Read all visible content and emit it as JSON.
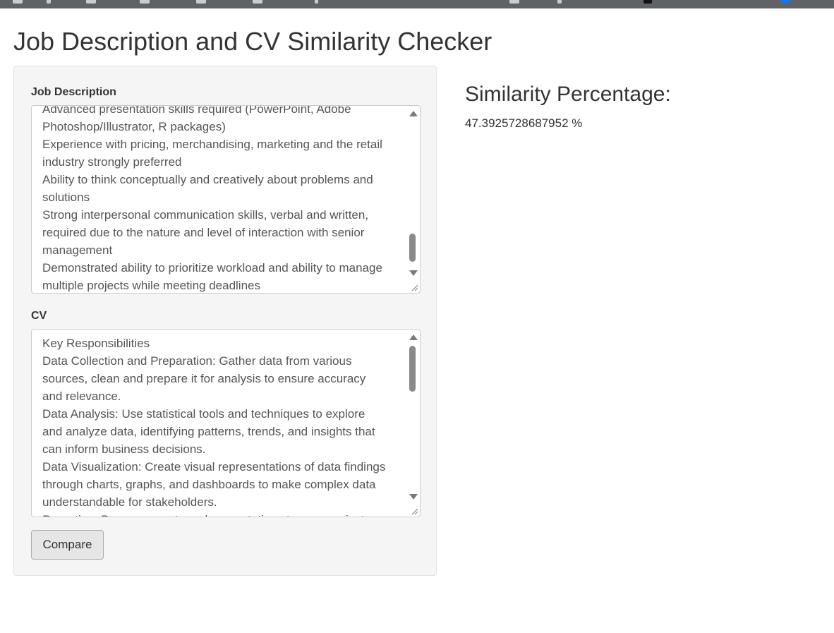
{
  "page": {
    "title": "Job Description and CV Similarity Checker"
  },
  "form": {
    "job_description": {
      "label": "Job Description",
      "lines": [
        "Advanced presentation skills required (PowerPoint, Adobe",
        "Photoshop/Illustrator, R packages)",
        "Experience with pricing, merchandising, marketing and the retail",
        "industry strongly preferred",
        "Ability to think conceptually and creatively about problems and",
        "solutions",
        "Strong interpersonal communication skills, verbal and written,",
        "required due to the nature and level of interaction with senior",
        "management",
        "Demonstrated ability to prioritize workload and ability to manage",
        "multiple projects while meeting deadlines"
      ]
    },
    "cv": {
      "label": "CV",
      "lines": [
        "Key Responsibilities",
        "Data Collection and Preparation: Gather data from various",
        "sources, clean and prepare it for analysis to ensure accuracy",
        "and relevance.",
        "Data Analysis: Use statistical tools and techniques to explore",
        "and analyze data, identifying patterns, trends, and insights that",
        "can inform business decisions.",
        "Data Visualization: Create visual representations of data findings",
        "through charts, graphs, and dashboards to make complex data",
        "understandable for stakeholders.",
        "Reporting: Prepare reports and presentations to communicate"
      ]
    },
    "compare_label": "Compare"
  },
  "result": {
    "heading": "Similarity Percentage:",
    "value": "47.3925728687952 %"
  }
}
